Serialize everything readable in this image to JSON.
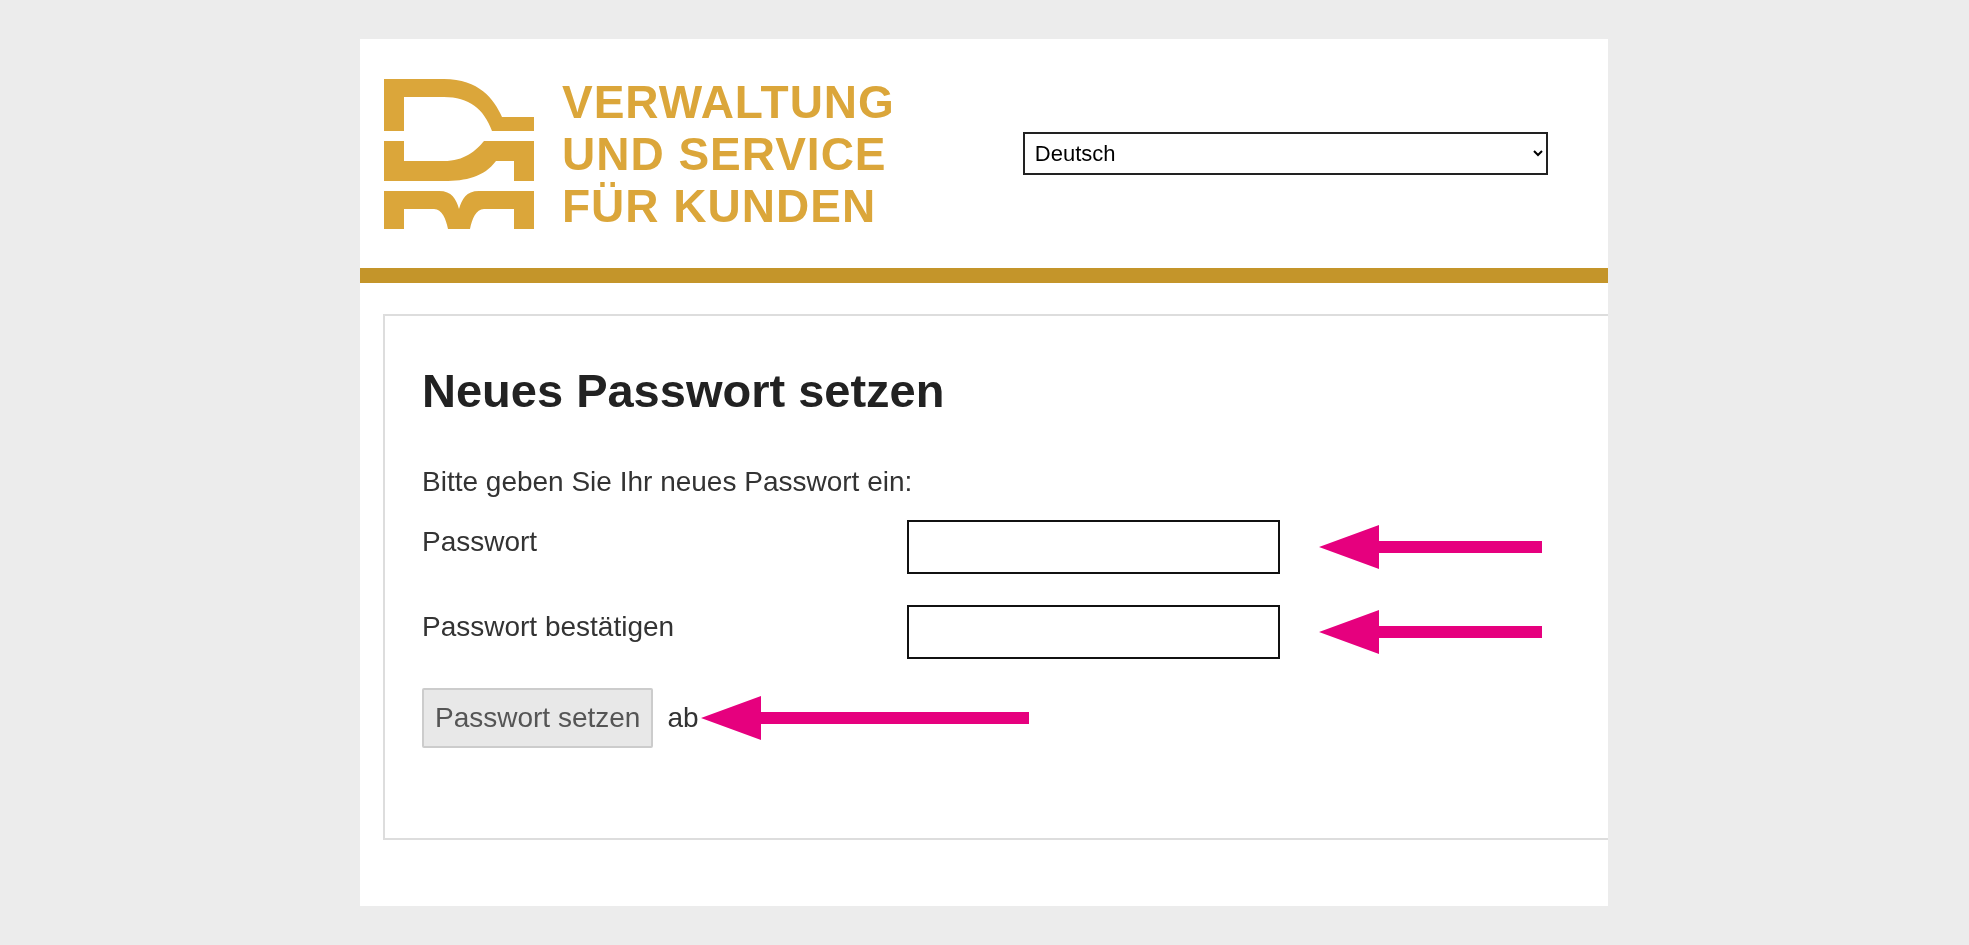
{
  "header": {
    "logo_text": [
      "VERWALTUNG",
      "UND SERVICE",
      "FÜR KUNDEN"
    ],
    "language": "Deutsch"
  },
  "form": {
    "title": "Neues Passwort setzen",
    "intro": "Bitte geben Sie Ihr neues Passwort ein:",
    "fields": [
      {
        "label": "Passwort"
      },
      {
        "label": "Passwort bestätigen"
      }
    ],
    "submit": "Passwort setzen",
    "cancel": "ab"
  }
}
